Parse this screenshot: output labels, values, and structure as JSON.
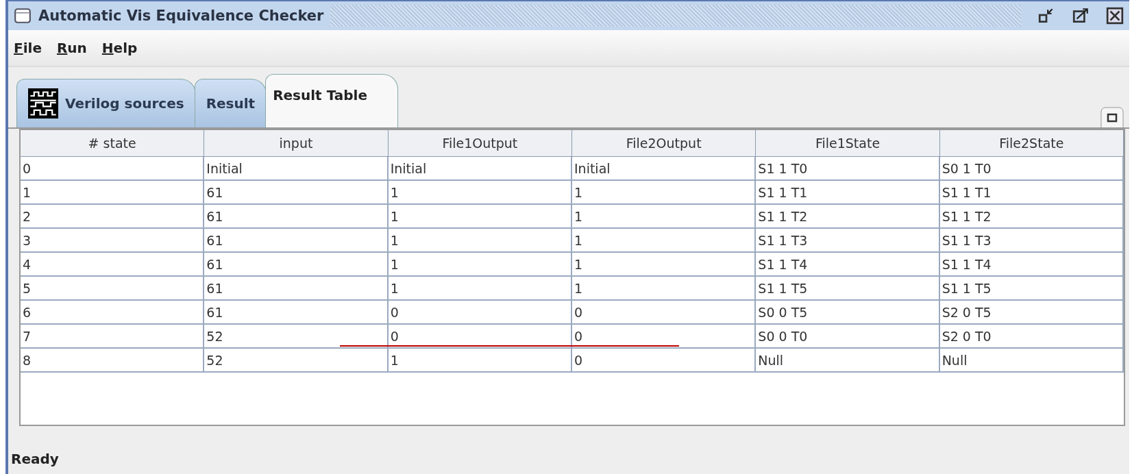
{
  "window": {
    "title": "Automatic Vis Equivalence Checker"
  },
  "menu": [
    "File",
    "Run",
    "Help"
  ],
  "tabs": [
    {
      "label": "Verilog sources",
      "selected": false,
      "icon": true
    },
    {
      "label": "Result",
      "selected": false,
      "icon": false
    },
    {
      "label": "Result Table",
      "selected": true,
      "icon": false
    }
  ],
  "table": {
    "columns": [
      "# state",
      "input",
      "File1Output",
      "File2Output",
      "File1State",
      "File2State"
    ],
    "rows": [
      [
        "0",
        "Initial",
        "Initial",
        "Initial",
        "S1 1 T0",
        "S0 1 T0"
      ],
      [
        "1",
        "61",
        "1",
        "1",
        "S1 1 T1",
        "S1 1 T1"
      ],
      [
        "2",
        "61",
        "1",
        "1",
        "S1 1 T2",
        "S1 1 T2"
      ],
      [
        "3",
        "61",
        "1",
        "1",
        "S1 1 T3",
        "S1 1 T3"
      ],
      [
        "4",
        "61",
        "1",
        "1",
        "S1 1 T4",
        "S1 1 T4"
      ],
      [
        "5",
        "61",
        "1",
        "1",
        "S1 1 T5",
        "S1 1 T5"
      ],
      [
        "6",
        "61",
        "0",
        "0",
        "S0 0 T5",
        "S2 0 T5"
      ],
      [
        "7",
        "52",
        "0",
        "0",
        "S0 0 T0",
        "S2 0 T0"
      ],
      [
        "8",
        "52",
        "1",
        "0",
        "Null",
        "Null"
      ]
    ]
  },
  "status_bar": "Ready"
}
